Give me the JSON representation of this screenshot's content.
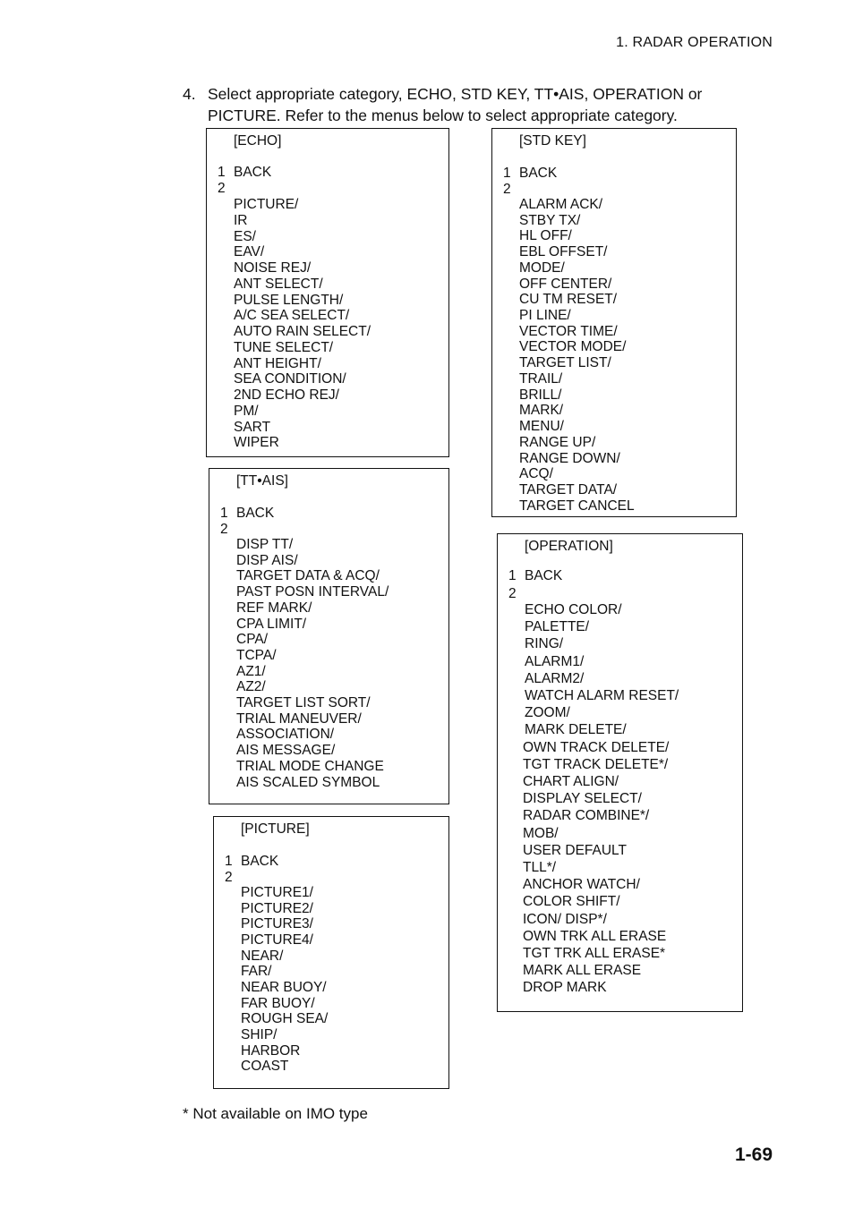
{
  "header": {
    "section": "1. RADAR  OPERATION"
  },
  "instruction": {
    "number": "4.",
    "lines": [
      "Select appropriate category, ECHO, STD KEY, TT•AIS, OPERATION or",
      "PICTURE. Refer to the menus below to select appropriate category."
    ]
  },
  "menus": {
    "echo": {
      "title": "[ECHO]",
      "index_1": "1",
      "back": "BACK",
      "index_2": "2",
      "items": [
        "PICTURE/",
        "IR",
        "ES/",
        "EAV/",
        "NOISE REJ/",
        "ANT SELECT/",
        "PULSE LENGTH/",
        "A/C SEA SELECT/",
        "AUTO RAIN SELECT/",
        "TUNE SELECT/",
        "ANT HEIGHT/",
        "SEA CONDITION/",
        "2ND ECHO REJ/",
        "PM/",
        "SART",
        "WIPER"
      ]
    },
    "std_key": {
      "title": "[STD KEY]",
      "index_1": "1",
      "back": "BACK",
      "index_2": "2",
      "items": [
        "ALARM ACK/",
        "STBY TX/",
        "HL OFF/",
        "EBL OFFSET/",
        "MODE/",
        "OFF CENTER/",
        "CU TM RESET/",
        "PI LINE/",
        "VECTOR TIME/",
        "VECTOR MODE/",
        "TARGET LIST/",
        "TRAIL/",
        "BRILL/",
        "MARK/",
        "MENU/",
        "RANGE UP/",
        "RANGE DOWN/",
        "ACQ/",
        "TARGET DATA/",
        "TARGET CANCEL"
      ]
    },
    "tt_ais": {
      "title": "[TT•AIS]",
      "index_1": "1",
      "back": "BACK",
      "index_2": "2",
      "items": [
        "DISP TT/",
        "DISP AIS/",
        "TARGET DATA & ACQ/",
        "PAST POSN INTERVAL/",
        "REF MARK/",
        "CPA LIMIT/",
        "CPA/",
        "TCPA/",
        "AZ1/",
        "AZ2/",
        "TARGET LIST SORT/",
        "TRIAL MANEUVER/",
        "ASSOCIATION/",
        "AIS MESSAGE/",
        "TRIAL MODE CHANGE",
        "AIS SCALED SYMBOL"
      ]
    },
    "picture": {
      "title": "[PICTURE]",
      "index_1": "1",
      "back": "BACK",
      "index_2": "2",
      "items": [
        "PICTURE1/",
        "PICTURE2/",
        "PICTURE3/",
        "PICTURE4/",
        "NEAR/",
        "FAR/",
        "NEAR BUOY/",
        "FAR BUOY/",
        "ROUGH SEA/",
        "SHIP/",
        "HARBOR",
        "COAST"
      ]
    },
    "operation": {
      "title": "[OPERATION]",
      "index_1": "1",
      "back": "BACK",
      "index_2": "2",
      "items": [
        "ECHO COLOR/",
        "PALETTE/",
        "RING/",
        "ALARM1/",
        "ALARM2/",
        "WATCH ALARM RESET/",
        "ZOOM/",
        "MARK DELETE/",
        "OWN TRACK DELETE/",
        "TGT TRACK DELETE*/",
        "CHART ALIGN/",
        "DISPLAY SELECT/",
        "RADAR COMBINE*/",
        "MOB/",
        "USER DEFAULT",
        "TLL*/",
        "ANCHOR WATCH/",
        "COLOR SHIFT/",
        "ICON/ DISP*/",
        "OWN TRK ALL ERASE",
        "TGT TRK ALL ERASE*",
        "MARK ALL ERASE",
        "DROP MARK"
      ]
    }
  },
  "footnote": "* Not available on IMO type",
  "page_number": "1-69"
}
